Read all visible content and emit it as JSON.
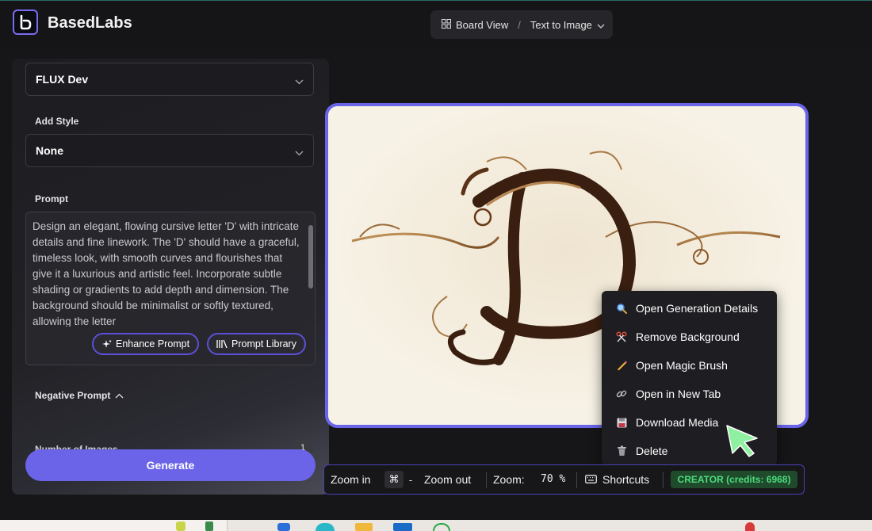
{
  "header": {
    "brand": "BasedLabs",
    "breadcrumb": {
      "view": "Board View",
      "separator": "/",
      "page": "Text to Image"
    }
  },
  "panel": {
    "model_value": "FLUX Dev",
    "style_label": "Add Style",
    "style_value": "None",
    "prompt_label": "Prompt",
    "prompt_text": "Design an elegant, flowing cursive letter 'D' with intricate details and fine linework. The 'D' should have a graceful, timeless look, with smooth curves and flourishes that give it a luxurious and artistic feel. Incorporate subtle shading or gradients to add depth and dimension. The background should be minimalist or softly textured, allowing the letter",
    "enhance_label": "Enhance Prompt",
    "library_label": "Prompt Library",
    "negative_label": "Negative Prompt",
    "num_images_label": "Number of Images",
    "num_images_value": "1",
    "generate_label": "Generate"
  },
  "context_menu": [
    {
      "label": "Open Generation Details",
      "icon": "magnifier-icon"
    },
    {
      "label": "Remove Background",
      "icon": "scissors-icon"
    },
    {
      "label": "Open Magic Brush",
      "icon": "pencil-icon"
    },
    {
      "label": "Open in New Tab",
      "icon": "link-icon"
    },
    {
      "label": "Download Media",
      "icon": "floppy-disk-icon"
    },
    {
      "label": "Delete",
      "icon": "trash-icon"
    }
  ],
  "toolbar": {
    "zoom_in_label": "Zoom in",
    "zoom_out_key_1": "⌘",
    "zoom_out_key_2": "-",
    "zoom_out_label": "Zoom out",
    "zoom_label": "Zoom:",
    "zoom_value": "70 %",
    "shortcuts_label": "Shortcuts",
    "credits_badge": "CREATOR (credits: 6968)"
  },
  "colors": {
    "accent": "#6b64e8",
    "badge_text": "#4ddc7c",
    "image_bg": "#f7f2e6",
    "letter_brown": "#3a1f10"
  }
}
